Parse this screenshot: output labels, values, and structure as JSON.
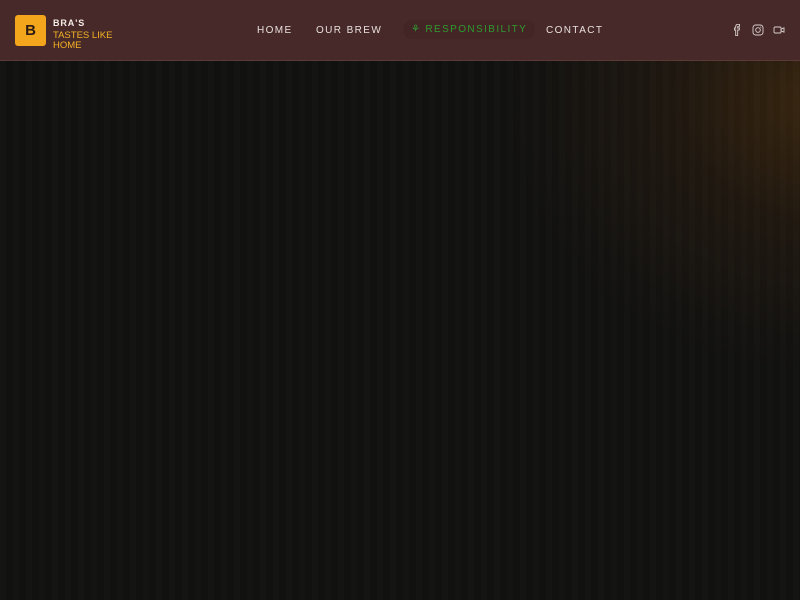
{
  "brand": {
    "logo_letter": "B",
    "name": "BRA'S",
    "tagline": "TASTES LIKE HOME",
    "accent_color": "#f3a51c"
  },
  "nav": {
    "items": [
      {
        "label": "HOME"
      },
      {
        "label": "OUR BREW"
      },
      {
        "label": "RESPONSIBILITY",
        "icon": "leaf-icon",
        "active": true,
        "color": "#2f9a2f"
      },
      {
        "label": "CONTACT"
      }
    ]
  },
  "social": {
    "icons": [
      "facebook-icon",
      "instagram-icon",
      "video-icon"
    ]
  },
  "colors": {
    "header_bg": "#47292a",
    "page_bg": "#111110"
  }
}
